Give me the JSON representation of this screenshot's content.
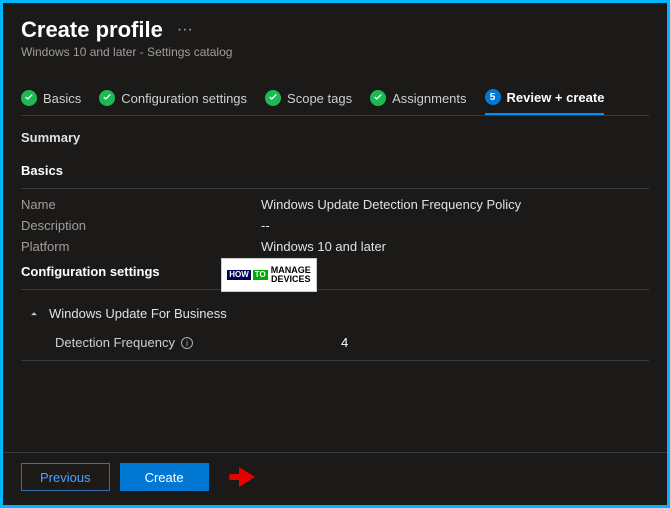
{
  "header": {
    "title": "Create profile",
    "subtitle": "Windows 10 and later - Settings catalog"
  },
  "stepper": {
    "steps": [
      {
        "label": "Basics",
        "state": "done"
      },
      {
        "label": "Configuration settings",
        "state": "done"
      },
      {
        "label": "Scope tags",
        "state": "done"
      },
      {
        "label": "Assignments",
        "state": "done"
      },
      {
        "label": "Review + create",
        "state": "current",
        "num": "5"
      }
    ]
  },
  "content": {
    "summary_label": "Summary",
    "basics_heading": "Basics",
    "basics": {
      "name_label": "Name",
      "name_value": "Windows Update Detection Frequency Policy",
      "description_label": "Description",
      "description_value": "--",
      "platform_label": "Platform",
      "platform_value": "Windows 10 and later"
    },
    "config_heading": "Configuration settings",
    "accordion_title": "Windows Update For Business",
    "detection_label": "Detection Frequency",
    "detection_value": "4"
  },
  "footer": {
    "previous": "Previous",
    "create": "Create"
  },
  "watermark": {
    "how": "HOW",
    "to": "TO",
    "line1": "MANAGE",
    "line2": "DEVICES"
  }
}
